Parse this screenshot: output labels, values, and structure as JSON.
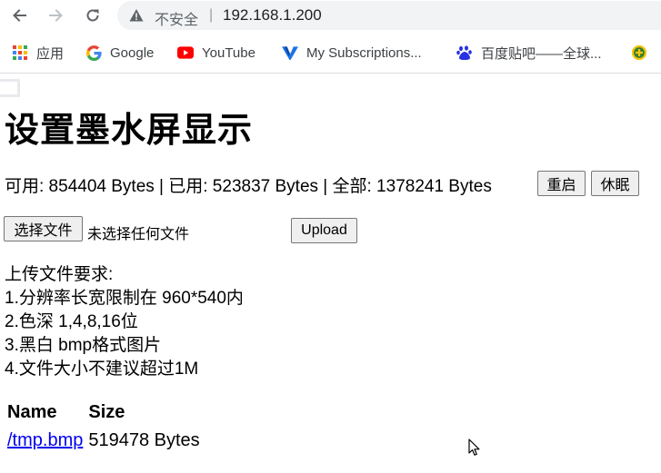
{
  "browser": {
    "security_label": "不安全",
    "separator": "|",
    "url": "192.168.1.200",
    "bookmarks": [
      {
        "label": "应用",
        "icon": "apps-grid-icon"
      },
      {
        "label": "Google",
        "icon": "google-icon"
      },
      {
        "label": "YouTube",
        "icon": "youtube-icon"
      },
      {
        "label": "My Subscriptions...",
        "icon": "subscriptions-icon"
      },
      {
        "label": "百度贴吧——全球...",
        "icon": "baidu-paw-icon"
      }
    ]
  },
  "page": {
    "title": "设置墨水屏显示",
    "memory_line": "可用: 854404 Bytes | 已用: 523837 Bytes | 全部: 1378241 Bytes",
    "restart_label": "重启",
    "sleep_label": "休眠",
    "choose_file_label": "选择文件",
    "no_file_text": "未选择任何文件",
    "upload_label": "Upload",
    "requirements": [
      "上传文件要求:",
      "1.分辨率长宽限制在 960*540内",
      "2.色深 1,4,8,16位",
      "3.黑白 bmp格式图片",
      "4.文件大小不建议超过1M"
    ],
    "files_table": {
      "headers": [
        "Name",
        "Size"
      ],
      "rows": [
        {
          "name": "/tmp.bmp",
          "size": "519478 Bytes"
        }
      ]
    }
  },
  "colors": {
    "link": "#0000ee",
    "omnibox_bg": "#f1f3f4",
    "youtube_red": "#ff0000"
  }
}
